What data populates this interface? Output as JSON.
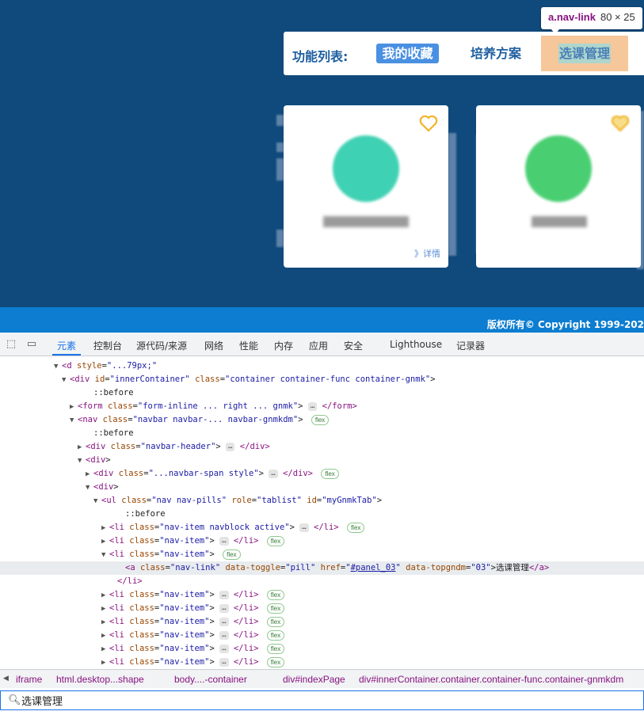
{
  "tooltip": {
    "selector": "a.nav-link",
    "size": "80 × 25"
  },
  "navbar": {
    "title": "功能列表:",
    "links": [
      "我的收藏",
      "培养方案",
      "选课管理"
    ]
  },
  "cards": [
    {
      "more": "》详情"
    },
    {
      "more": ""
    }
  ],
  "footer": {
    "copyright": "版权所有© Copyright 1999-202"
  },
  "devtools": {
    "tabs": [
      "元素",
      "控制台",
      "源代码/来源",
      "网络",
      "性能",
      "内存",
      "应用",
      "安全",
      "Lighthouse",
      "记录器"
    ],
    "dom_lines": [
      {
        "indent": 7,
        "arrow": "▼",
        "html": "<span class='tag'>&lt;d</span> <span class='attr'>style</span>=<span class='val'>\"...79px;\"</span>"
      },
      {
        "indent": 8,
        "arrow": "▼",
        "html": "<span class='tag'>&lt;div</span> <span class='attr'>id</span>=<span class='val'>\"innerContainer\"</span> <span class='attr'>class</span>=<span class='val'>\"container container-func container-gnmk\"</span>&gt;"
      },
      {
        "indent": 11,
        "arrow": "",
        "html": "::before"
      },
      {
        "indent": 9,
        "arrow": "▶",
        "html": "<span class='tag'>&lt;form</span> <span class='attr'>class</span>=<span class='val'>\"form-inline ... right ... gnmk\"</span>&gt; <span class='ellip'>…</span> <span class='tag'>&lt;/form&gt;</span>"
      },
      {
        "indent": 9,
        "arrow": "▼",
        "html": "<span class='tag'>&lt;nav</span> <span class='attr'>class</span>=<span class='val'>\"navbar navbar-... navbar-gnmkdm\"</span>&gt; <span class='badge'>flex</span>"
      },
      {
        "indent": 11,
        "arrow": "",
        "html": "::before"
      },
      {
        "indent": 10,
        "arrow": "▶",
        "html": "<span class='tag'>&lt;div</span> <span class='attr'>class</span>=<span class='val'>\"navbar-header\"</span>&gt; <span class='ellip'>…</span> <span class='tag'>&lt;/div&gt;</span>"
      },
      {
        "indent": 10,
        "arrow": "▼",
        "html": "<span class='tag'>&lt;div</span>&gt;"
      },
      {
        "indent": 11,
        "arrow": "▶",
        "html": "<span class='tag'>&lt;div</span> <span class='attr'>class</span>=<span class='val'>\"...navbar-span style\"</span>&gt; <span class='ellip'>…</span> <span class='tag'>&lt;/div&gt;</span> <span class='badge'>flex</span>"
      },
      {
        "indent": 11,
        "arrow": "▼",
        "html": "<span class='tag'>&lt;div</span>&gt;"
      },
      {
        "indent": 12,
        "arrow": "▼",
        "html": "<span class='tag'>&lt;ul</span> <span class='attr'>class</span>=<span class='val'>\"nav nav-pills\"</span> <span class='attr'>role</span>=<span class='val'>\"tablist\"</span> <span class='attr'>id</span>=<span class='val'>\"myGnmkTab\"</span>&gt;"
      },
      {
        "indent": 15,
        "arrow": "",
        "html": "::before"
      },
      {
        "indent": 13,
        "arrow": "▶",
        "html": "<span class='tag'>&lt;li</span> <span class='attr'>class</span>=<span class='val'>\"nav-item navblock active\"</span>&gt; <span class='ellip'>…</span> <span class='tag'>&lt;/li&gt;</span> <span class='badge'>flex</span>"
      },
      {
        "indent": 13,
        "arrow": "▶",
        "html": "<span class='tag'>&lt;li</span> <span class='attr'>class</span>=<span class='val'>\"nav-item\"</span>&gt; <span class='ellip'>…</span> <span class='tag'>&lt;/li&gt;</span> <span class='badge'>flex</span>"
      },
      {
        "indent": 13,
        "arrow": "▼",
        "html": "<span class='tag'>&lt;li</span> <span class='attr'>class</span>=<span class='val'>\"nav-item\"</span>&gt; <span class='badge'>flex</span>"
      },
      {
        "indent": 15,
        "arrow": "",
        "html": "<span class='tag'>&lt;a</span> <span class='attr'>class</span>=<span class='val'>\"nav-link\"</span> <span class='attr'>data-toggle</span>=<span class='val'>\"pill\"</span> <span class='attr'>href</span>=<span class='val'>\"<u>#panel_03</u>\"</span> <span class='attr'>data-topgndm</span>=<span class='val'>\"03\"</span>&gt;<span class='txt'>选课管理</span><span class='tag'>&lt;/a&gt;</span>",
        "hl": true
      },
      {
        "indent": 14,
        "arrow": "",
        "html": "<span class='tag'>&lt;/li&gt;</span>"
      },
      {
        "indent": 13,
        "arrow": "▶",
        "html": "<span class='tag'>&lt;li</span> <span class='attr'>class</span>=<span class='val'>\"nav-item\"</span>&gt; <span class='ellip'>…</span> <span class='tag'>&lt;/li&gt;</span> <span class='badge'>flex</span>"
      },
      {
        "indent": 13,
        "arrow": "▶",
        "html": "<span class='tag'>&lt;li</span> <span class='attr'>class</span>=<span class='val'>\"nav-item\"</span>&gt; <span class='ellip'>…</span> <span class='tag'>&lt;/li&gt;</span> <span class='badge'>flex</span>"
      },
      {
        "indent": 13,
        "arrow": "▶",
        "html": "<span class='tag'>&lt;li</span> <span class='attr'>class</span>=<span class='val'>\"nav-item\"</span>&gt; <span class='ellip'>…</span> <span class='tag'>&lt;/li&gt;</span> <span class='badge'>flex</span>"
      },
      {
        "indent": 13,
        "arrow": "▶",
        "html": "<span class='tag'>&lt;li</span> <span class='attr'>class</span>=<span class='val'>\"nav-item\"</span>&gt; <span class='ellip'>…</span> <span class='tag'>&lt;/li&gt;</span> <span class='badge'>flex</span>"
      },
      {
        "indent": 13,
        "arrow": "▶",
        "html": "<span class='tag'>&lt;li</span> <span class='attr'>class</span>=<span class='val'>\"nav-item\"</span>&gt; <span class='ellip'>…</span> <span class='tag'>&lt;/li&gt;</span> <span class='badge'>flex</span>"
      },
      {
        "indent": 13,
        "arrow": "▶",
        "html": "<span class='tag'>&lt;li</span> <span class='attr'>class</span>=<span class='val'>\"nav-item\"</span>&gt; <span class='ellip'>…</span> <span class='tag'>&lt;/li&gt;</span> <span class='badge'>flex</span>"
      }
    ],
    "breadcrumbs": [
      "iframe",
      "html.desktop...shape",
      "body....-container",
      "div#indexPage",
      "div#innerContainer.container.container-func.container-gnmkdm"
    ],
    "search_value": "选课管理"
  },
  "colors": {
    "page_bg": "#104a7d",
    "footer_bg": "#0c7dd0",
    "accent": "#1a73e8"
  }
}
